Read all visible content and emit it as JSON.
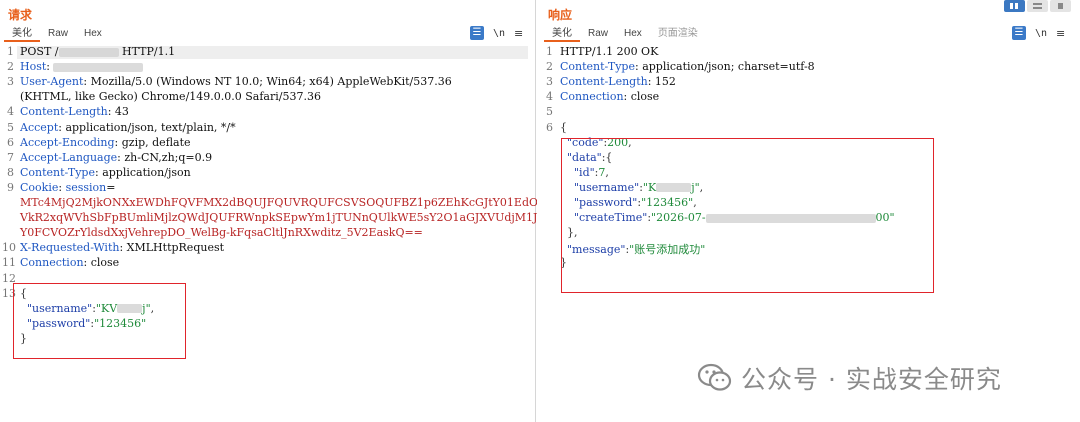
{
  "request": {
    "title": "请求",
    "tabs": [
      "美化",
      "Raw",
      "Hex"
    ],
    "tool_ln": "\\n",
    "tool_menu": "≡",
    "lines": [
      {
        "n": "1",
        "parts": [
          [
            "POST /",
            ""
          ],
          [
            "",
            "blur60"
          ],
          [
            " HTTP/1.1",
            ""
          ]
        ]
      },
      {
        "n": "2",
        "parts": [
          [
            "Host",
            "hn"
          ],
          [
            ": ",
            ""
          ],
          [
            "",
            "blur90"
          ]
        ]
      },
      {
        "n": "3",
        "parts": [
          [
            "User-Agent",
            "hn"
          ],
          [
            ": Mozilla/5.0 (Windows NT 10.0; Win64; x64) AppleWebKit/537.36",
            ""
          ]
        ]
      },
      {
        "n": "",
        "parts": [
          [
            "(KHTML, like Gecko) Chrome/149.0.0.0 Safari/537.36",
            ""
          ]
        ]
      },
      {
        "n": "4",
        "parts": [
          [
            "Content-Length",
            "hn"
          ],
          [
            ": 43",
            ""
          ]
        ]
      },
      {
        "n": "5",
        "parts": [
          [
            "Accept",
            "hn"
          ],
          [
            ": application/json, text/plain, */*",
            ""
          ]
        ]
      },
      {
        "n": "6",
        "parts": [
          [
            "Accept-Encoding",
            "hn"
          ],
          [
            ": gzip, deflate",
            ""
          ]
        ]
      },
      {
        "n": "7",
        "parts": [
          [
            "Accept-Language",
            "hn"
          ],
          [
            ": zh-CN,zh;q=0.9",
            ""
          ]
        ]
      },
      {
        "n": "8",
        "parts": [
          [
            "Content-Type",
            "hn"
          ],
          [
            ": application/json",
            ""
          ]
        ]
      },
      {
        "n": "9",
        "parts": [
          [
            "Cookie",
            "hn"
          ],
          [
            ": ",
            ""
          ],
          [
            "session",
            "hn"
          ],
          [
            "=",
            ""
          ]
        ]
      },
      {
        "n": "",
        "parts": [
          [
            "MTc4MjQ2MjkONXxEWDhFQVFMX2dBQUJFQUVRQUFCSVSOQUFBZ1p6ZEhKcGJtY01EdOFOWVhWMGFHVn",
            "ck"
          ]
        ]
      },
      {
        "n": "",
        "parts": [
          [
            "VkR2xqWVhSbFpBUmliMjlzQWdJQUFRWnpkSEpwYm1jTUNnQUlkWE5sY2O1aGJXVUdjM1J5YVc1bkRB",
            "ck"
          ]
        ]
      },
      {
        "n": "",
        "parts": [
          [
            "Y0FCVOZrYldsdXxjVehrepDO_WelBg-kFqsaCltlJnRXwditz_5V2EaskQ==",
            "ck"
          ]
        ]
      },
      {
        "n": "10",
        "parts": [
          [
            "X-Requested-With",
            "hn"
          ],
          [
            ": XMLHttpRequest",
            ""
          ]
        ]
      },
      {
        "n": "11",
        "parts": [
          [
            "Connection",
            "hn"
          ],
          [
            ": close",
            ""
          ]
        ]
      },
      {
        "n": "12",
        "parts": []
      },
      {
        "n": "13",
        "parts": [
          [
            "{",
            "jp"
          ]
        ]
      },
      {
        "n": "",
        "parts": [
          [
            "  \"username\"",
            "jk"
          ],
          [
            ":",
            "jp"
          ],
          [
            "\"KV",
            "js"
          ],
          [
            "",
            "blur25"
          ],
          [
            "j\"",
            "js"
          ],
          [
            ",",
            "jp"
          ]
        ]
      },
      {
        "n": "",
        "parts": [
          [
            "  \"password\"",
            "jk"
          ],
          [
            ":",
            "jp"
          ],
          [
            "\"123456\"",
            "js"
          ]
        ]
      },
      {
        "n": "",
        "parts": [
          [
            "}",
            "jp"
          ]
        ]
      }
    ]
  },
  "response": {
    "title": "响应",
    "tabs": [
      "美化",
      "Raw",
      "Hex",
      "页面渲染"
    ],
    "tool_ln": "\\n",
    "tool_menu": "≡",
    "lines": [
      {
        "n": "1",
        "parts": [
          [
            "HTTP/1.1 200 OK",
            ""
          ]
        ]
      },
      {
        "n": "2",
        "parts": [
          [
            "Content-Type",
            "hn"
          ],
          [
            ": application/json; charset=utf-8",
            ""
          ]
        ]
      },
      {
        "n": "3",
        "parts": [
          [
            "Content-Length",
            "hn"
          ],
          [
            ": 152",
            ""
          ]
        ]
      },
      {
        "n": "4",
        "parts": [
          [
            "Connection",
            "hn"
          ],
          [
            ": close",
            ""
          ]
        ]
      },
      {
        "n": "5",
        "parts": []
      },
      {
        "n": "6",
        "parts": [
          [
            "{",
            "jp"
          ]
        ]
      },
      {
        "n": "",
        "parts": [
          [
            "  \"code\"",
            "jk"
          ],
          [
            ":",
            "jp"
          ],
          [
            "200",
            "js"
          ],
          [
            ",",
            "jp"
          ]
        ]
      },
      {
        "n": "",
        "parts": [
          [
            "  \"data\"",
            "jk"
          ],
          [
            ":{",
            "jp"
          ]
        ]
      },
      {
        "n": "",
        "parts": [
          [
            "    \"id\"",
            "jk"
          ],
          [
            ":",
            "jp"
          ],
          [
            "7",
            "js"
          ],
          [
            ",",
            "jp"
          ]
        ]
      },
      {
        "n": "",
        "parts": [
          [
            "    \"username\"",
            "jk"
          ],
          [
            ":",
            "jp"
          ],
          [
            "\"K",
            "js"
          ],
          [
            "",
            "blur35"
          ],
          [
            "j\"",
            "js"
          ],
          [
            ",",
            "jp"
          ]
        ]
      },
      {
        "n": "",
        "parts": [
          [
            "    \"password\"",
            "jk"
          ],
          [
            ":",
            "jp"
          ],
          [
            "\"123456\"",
            "js"
          ],
          [
            ",",
            "jp"
          ]
        ]
      },
      {
        "n": "",
        "parts": [
          [
            "    \"createTime\"",
            "jk"
          ],
          [
            ":",
            "jp"
          ],
          [
            "\"2026-07-",
            "js"
          ],
          [
            "",
            "blur170"
          ],
          [
            "00\"",
            "js"
          ]
        ]
      },
      {
        "n": "",
        "parts": [
          [
            "  }",
            "jp"
          ],
          [
            ",",
            "jp"
          ]
        ]
      },
      {
        "n": "",
        "parts": [
          [
            "  \"message\"",
            "jk"
          ],
          [
            ":",
            "jp"
          ],
          [
            "\"账号添加成功\"",
            "js"
          ]
        ]
      },
      {
        "n": "",
        "parts": [
          [
            "}",
            "jp"
          ]
        ]
      }
    ]
  },
  "watermark": {
    "text": "公众号 · 实战安全研究"
  },
  "colors": {
    "accent": "#e8601c",
    "header_name": "#1f57c2",
    "cookie": "#b82525",
    "json_key": "#1e3fa8",
    "json_string": "#1f8a3a",
    "highlight_box": "#e0242b"
  }
}
